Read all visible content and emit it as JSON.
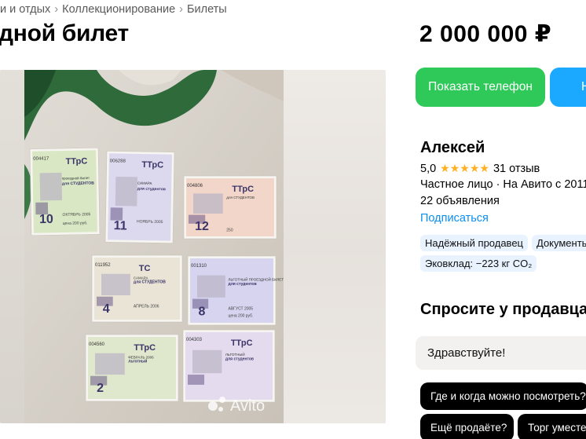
{
  "breadcrumbs": [
    "и и отдых",
    "Коллекционирование",
    "Билеты"
  ],
  "listing": {
    "title": "дной билет",
    "price": "2 000 000 ₽"
  },
  "actions": {
    "show_phone": "Показать телефон",
    "write_message": "Н"
  },
  "seller": {
    "name": "Алексей",
    "rating": "5,0",
    "stars": "★★★★★",
    "reviews": "31 отзыв",
    "type": "Частное лицо · На Авито с 2011",
    "ads_count": "22 объявления",
    "subscribe": "Подписаться",
    "badges": [
      "Надёжный продавец",
      "Документы",
      "Эковклад: −223 кг CO₂"
    ]
  },
  "ask": {
    "title": "Спросите у продавца",
    "input_value": "Здравствуйте!",
    "quick_replies": [
      "Где и когда можно посмотреть?",
      "Ещё продаёте?",
      "Торг уместе"
    ]
  },
  "photo": {
    "watermark": "Avito",
    "tickets": [
      {
        "serial": "004417",
        "brand": "ТТрС",
        "line1": "проездной билет",
        "line2": "для СТУДЕНТОВ",
        "month": "ОКТЯБРЬ 2005",
        "number": "10",
        "price": "цена 200 руб.",
        "color": "#d9e7c4"
      },
      {
        "serial": "006288",
        "brand": "ТТрС",
        "line1": "САМАРА",
        "line2": "для студентов",
        "month": "НОЯБРЬ 2005",
        "number": "11",
        "price": "",
        "color": "#dcd9ee"
      },
      {
        "serial": "004806",
        "brand": "ТТрС",
        "line1": "для СТУДЕНТОВ",
        "line2": "",
        "month": "",
        "number": "12",
        "price": "250",
        "color": "#f2d6c9"
      },
      {
        "serial": "011952",
        "brand": "ТС",
        "line1": "САМАРА",
        "line2": "для СТУДЕНТОВ",
        "month": "АПРЕЛЬ 2006",
        "number": "4",
        "price": "",
        "color": "#e9e4d6"
      },
      {
        "serial": "001310",
        "brand": "",
        "line1": "ЛЬГОТНЫЙ ПРОЕЗДНОЙ БИЛЕТ",
        "line2": "для студентов",
        "month": "АВГУСТ 2005",
        "number": "8",
        "price": "цена 200 руб.",
        "color": "#d6d4ee"
      },
      {
        "serial": "004560",
        "brand": "ТТрС",
        "line1": "ФЕВРАЛЬ 2006",
        "line2": "льготный",
        "month": "",
        "number": "2",
        "price": "",
        "color": "#dfe7cd"
      },
      {
        "serial": "004303",
        "brand": "ТТрС",
        "line1": "ЛЬГОТНЫЙ",
        "line2": "для студентов",
        "month": "",
        "number": "",
        "price": "",
        "color": "#e4dcee"
      }
    ]
  }
}
